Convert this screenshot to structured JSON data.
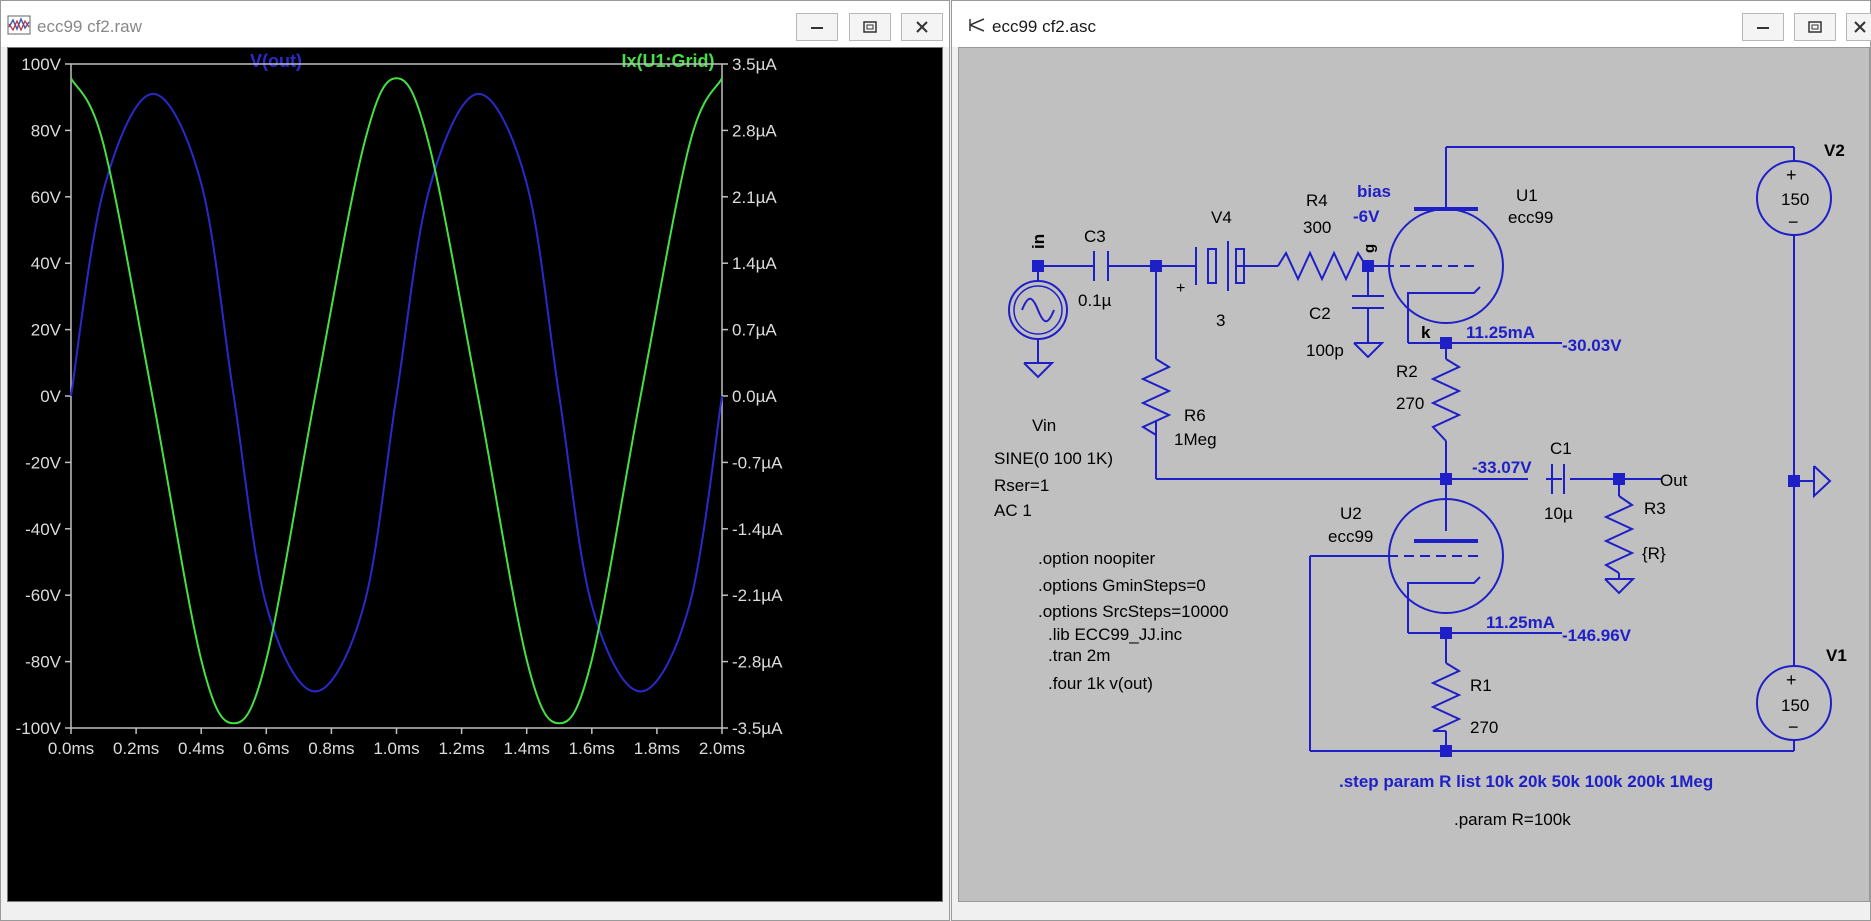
{
  "plot_window": {
    "title": "ecc99 cf2.raw",
    "trace_labels": {
      "vout": "V(out)",
      "grid": "Ix(U1:Grid)"
    },
    "colors": {
      "vout": "#2a2acc",
      "grid": "#44e044",
      "background": "#000000",
      "axis": "#c0c0c0",
      "text": "#dcdcdc"
    },
    "buttons": {
      "minimize": "minimize-icon",
      "maximize": "maximize-icon",
      "close": "close-icon"
    }
  },
  "chart_data": {
    "type": "line",
    "x_ticks": [
      "0.0ms",
      "0.2ms",
      "0.4ms",
      "0.6ms",
      "0.8ms",
      "1.0ms",
      "1.2ms",
      "1.4ms",
      "1.6ms",
      "1.8ms",
      "2.0ms"
    ],
    "y_left_ticks": [
      "100V",
      "80V",
      "60V",
      "40V",
      "20V",
      "0V",
      "-20V",
      "-40V",
      "-60V",
      "-80V",
      "-100V"
    ],
    "y_right_ticks": [
      "3.5µA",
      "2.8µA",
      "2.1µA",
      "1.4µA",
      "0.7µA",
      "0.0µA",
      "-0.7µA",
      "-1.4µA",
      "-2.1µA",
      "-2.8µA",
      "-3.5µA"
    ],
    "xlim": [
      0,
      2.0
    ],
    "ylim_left": [
      -100,
      100
    ],
    "ylim_right": [
      -3.5,
      3.5
    ],
    "series": [
      {
        "name": "V(out)",
        "axis": "left",
        "x": [
          0,
          0.1,
          0.25,
          0.4,
          0.5,
          0.6,
          0.75,
          0.9,
          1.0,
          1.1,
          1.25,
          1.4,
          1.5,
          1.6,
          1.75,
          1.9,
          2.0
        ],
        "values": [
          0,
          62,
          91,
          64,
          0,
          -63,
          -89,
          -63,
          0,
          62,
          91,
          64,
          0,
          -63,
          -89,
          -63,
          0
        ]
      },
      {
        "name": "Ix(U1:Grid)",
        "axis": "right",
        "x": [
          0,
          0.1,
          0.25,
          0.4,
          0.5,
          0.6,
          0.75,
          0.9,
          1.0,
          1.1,
          1.25,
          1.4,
          1.5,
          1.6,
          1.75,
          1.9,
          2.0
        ],
        "values": [
          3.35,
          2.65,
          0,
          -2.78,
          -3.45,
          -2.78,
          0,
          2.65,
          3.35,
          2.65,
          0,
          -2.78,
          -3.45,
          -2.78,
          0,
          2.65,
          3.35
        ]
      }
    ]
  },
  "schematic_window": {
    "title": "ecc99 cf2.asc",
    "colors": {
      "wire": "#1f1fc8",
      "text": "#000000",
      "node_label": "#1f1fc8",
      "background": "#c0c0c0"
    },
    "components": {
      "vin": {
        "name": "Vin",
        "line1": "SINE(0 100 1K)",
        "line2": "Rser=1",
        "line3": "AC 1"
      },
      "c3": {
        "name": "C3",
        "value": "0.1µ"
      },
      "v4": {
        "name": "V4",
        "value": "3"
      },
      "r4": {
        "name": "R4",
        "value": "300"
      },
      "c2": {
        "name": "C2",
        "value": "100p"
      },
      "u1": {
        "name": "U1",
        "model": "ecc99"
      },
      "r2": {
        "name": "R2",
        "value": "270"
      },
      "r6": {
        "name": "R6",
        "value": "1Meg"
      },
      "c1": {
        "name": "C1",
        "value": "10µ"
      },
      "r3": {
        "name": "R3",
        "value": "{R}"
      },
      "u2": {
        "name": "U2",
        "model": "ecc99"
      },
      "r1": {
        "name": "R1",
        "value": "270"
      },
      "v2": {
        "name": "V2",
        "value": "150"
      },
      "v1": {
        "name": "V1",
        "value": "150"
      }
    },
    "labels": {
      "in": "in",
      "g": "g",
      "bias": "bias",
      "bias_v": "-6V",
      "k": "k",
      "u1_k_current": "11.25mA",
      "u1_k_voltage": "-30.03V",
      "mid_voltage": "-33.07V",
      "out": "Out",
      "u2_k_current": "11.25mA",
      "u2_k_voltage": "-146.96V",
      "plus": "+",
      "minus": "−"
    },
    "directives": [
      ".option noopiter",
      ".options GminSteps=0",
      ".options SrcSteps=10000",
      ".lib ECC99_JJ.inc",
      ".tran 2m",
      ".four 1k v(out)"
    ],
    "step_directive": ".step param R list 10k 20k 50k 100k 200k 1Meg",
    "param_directive": ".param R=100k"
  }
}
